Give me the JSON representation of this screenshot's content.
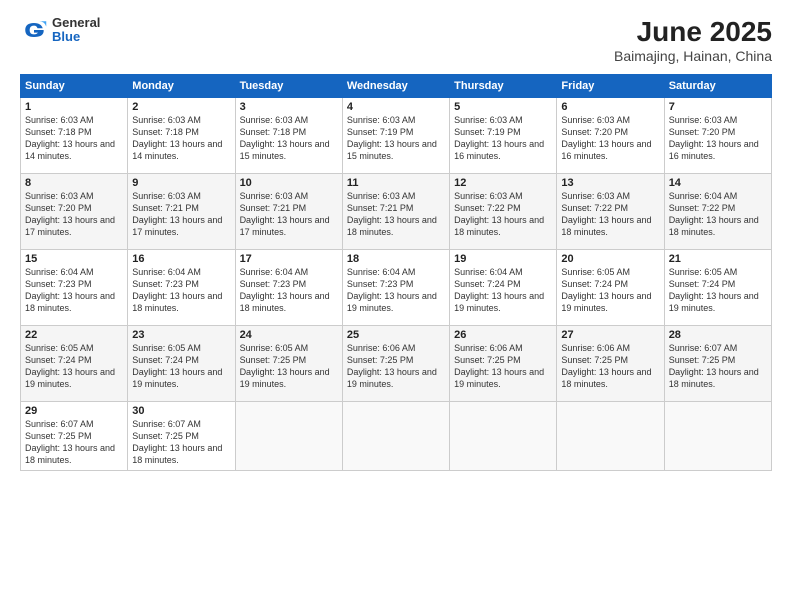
{
  "header": {
    "logo_general": "General",
    "logo_blue": "Blue",
    "month_title": "June 2025",
    "location": "Baimajing, Hainan, China"
  },
  "columns": [
    "Sunday",
    "Monday",
    "Tuesday",
    "Wednesday",
    "Thursday",
    "Friday",
    "Saturday"
  ],
  "weeks": [
    [
      {
        "day": "1",
        "sunrise": "6:03 AM",
        "sunset": "7:18 PM",
        "daylight": "13 hours and 14 minutes."
      },
      {
        "day": "2",
        "sunrise": "6:03 AM",
        "sunset": "7:18 PM",
        "daylight": "13 hours and 14 minutes."
      },
      {
        "day": "3",
        "sunrise": "6:03 AM",
        "sunset": "7:18 PM",
        "daylight": "13 hours and 15 minutes."
      },
      {
        "day": "4",
        "sunrise": "6:03 AM",
        "sunset": "7:19 PM",
        "daylight": "13 hours and 15 minutes."
      },
      {
        "day": "5",
        "sunrise": "6:03 AM",
        "sunset": "7:19 PM",
        "daylight": "13 hours and 16 minutes."
      },
      {
        "day": "6",
        "sunrise": "6:03 AM",
        "sunset": "7:20 PM",
        "daylight": "13 hours and 16 minutes."
      },
      {
        "day": "7",
        "sunrise": "6:03 AM",
        "sunset": "7:20 PM",
        "daylight": "13 hours and 16 minutes."
      }
    ],
    [
      {
        "day": "8",
        "sunrise": "6:03 AM",
        "sunset": "7:20 PM",
        "daylight": "13 hours and 17 minutes."
      },
      {
        "day": "9",
        "sunrise": "6:03 AM",
        "sunset": "7:21 PM",
        "daylight": "13 hours and 17 minutes."
      },
      {
        "day": "10",
        "sunrise": "6:03 AM",
        "sunset": "7:21 PM",
        "daylight": "13 hours and 17 minutes."
      },
      {
        "day": "11",
        "sunrise": "6:03 AM",
        "sunset": "7:21 PM",
        "daylight": "13 hours and 18 minutes."
      },
      {
        "day": "12",
        "sunrise": "6:03 AM",
        "sunset": "7:22 PM",
        "daylight": "13 hours and 18 minutes."
      },
      {
        "day": "13",
        "sunrise": "6:03 AM",
        "sunset": "7:22 PM",
        "daylight": "13 hours and 18 minutes."
      },
      {
        "day": "14",
        "sunrise": "6:04 AM",
        "sunset": "7:22 PM",
        "daylight": "13 hours and 18 minutes."
      }
    ],
    [
      {
        "day": "15",
        "sunrise": "6:04 AM",
        "sunset": "7:23 PM",
        "daylight": "13 hours and 18 minutes."
      },
      {
        "day": "16",
        "sunrise": "6:04 AM",
        "sunset": "7:23 PM",
        "daylight": "13 hours and 18 minutes."
      },
      {
        "day": "17",
        "sunrise": "6:04 AM",
        "sunset": "7:23 PM",
        "daylight": "13 hours and 18 minutes."
      },
      {
        "day": "18",
        "sunrise": "6:04 AM",
        "sunset": "7:23 PM",
        "daylight": "13 hours and 19 minutes."
      },
      {
        "day": "19",
        "sunrise": "6:04 AM",
        "sunset": "7:24 PM",
        "daylight": "13 hours and 19 minutes."
      },
      {
        "day": "20",
        "sunrise": "6:05 AM",
        "sunset": "7:24 PM",
        "daylight": "13 hours and 19 minutes."
      },
      {
        "day": "21",
        "sunrise": "6:05 AM",
        "sunset": "7:24 PM",
        "daylight": "13 hours and 19 minutes."
      }
    ],
    [
      {
        "day": "22",
        "sunrise": "6:05 AM",
        "sunset": "7:24 PM",
        "daylight": "13 hours and 19 minutes."
      },
      {
        "day": "23",
        "sunrise": "6:05 AM",
        "sunset": "7:24 PM",
        "daylight": "13 hours and 19 minutes."
      },
      {
        "day": "24",
        "sunrise": "6:05 AM",
        "sunset": "7:25 PM",
        "daylight": "13 hours and 19 minutes."
      },
      {
        "day": "25",
        "sunrise": "6:06 AM",
        "sunset": "7:25 PM",
        "daylight": "13 hours and 19 minutes."
      },
      {
        "day": "26",
        "sunrise": "6:06 AM",
        "sunset": "7:25 PM",
        "daylight": "13 hours and 19 minutes."
      },
      {
        "day": "27",
        "sunrise": "6:06 AM",
        "sunset": "7:25 PM",
        "daylight": "13 hours and 18 minutes."
      },
      {
        "day": "28",
        "sunrise": "6:07 AM",
        "sunset": "7:25 PM",
        "daylight": "13 hours and 18 minutes."
      }
    ],
    [
      {
        "day": "29",
        "sunrise": "6:07 AM",
        "sunset": "7:25 PM",
        "daylight": "13 hours and 18 minutes."
      },
      {
        "day": "30",
        "sunrise": "6:07 AM",
        "sunset": "7:25 PM",
        "daylight": "13 hours and 18 minutes."
      },
      null,
      null,
      null,
      null,
      null
    ]
  ]
}
